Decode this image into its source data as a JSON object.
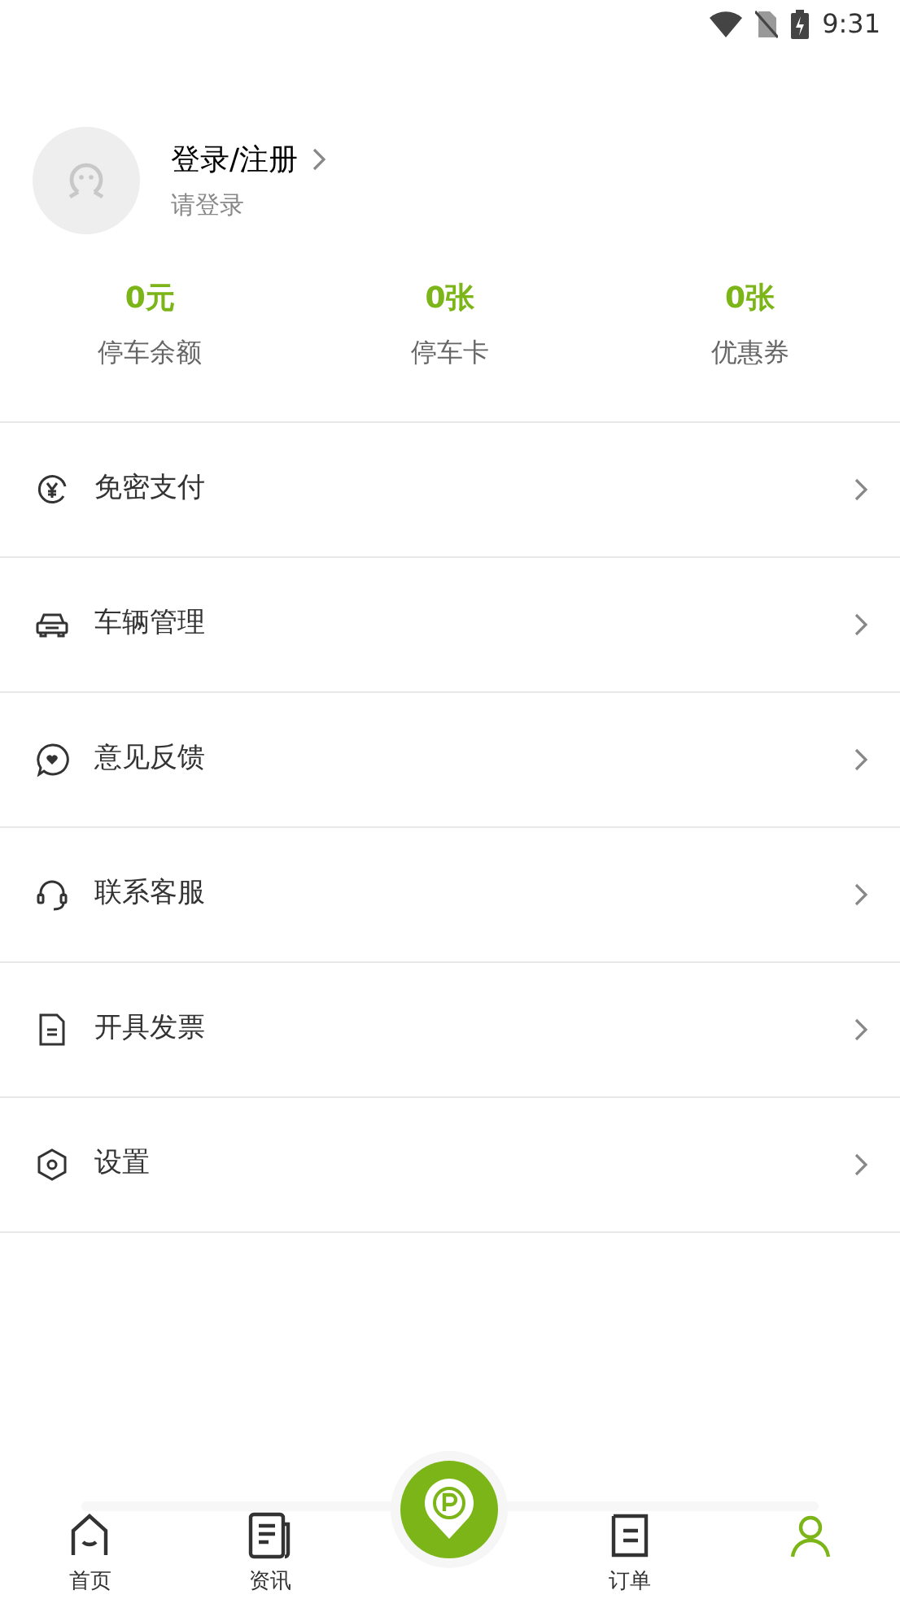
{
  "status_bar": {
    "time": "9:31"
  },
  "profile": {
    "title": "登录/注册",
    "subtitle": "请登录"
  },
  "stats": [
    {
      "value": "0元",
      "label": "停车余额"
    },
    {
      "value": "0张",
      "label": "停车卡"
    },
    {
      "value": "0张",
      "label": "优惠券"
    }
  ],
  "menu": [
    {
      "label": "免密支付"
    },
    {
      "label": "车辆管理"
    },
    {
      "label": "意见反馈"
    },
    {
      "label": "联系客服"
    },
    {
      "label": "开具发票"
    },
    {
      "label": "设置"
    }
  ],
  "tab_bar": [
    {
      "label": "首页",
      "selected": false
    },
    {
      "label": "资讯",
      "selected": false
    },
    {
      "label": "订单",
      "selected": false
    },
    {
      "selected": true
    }
  ]
}
